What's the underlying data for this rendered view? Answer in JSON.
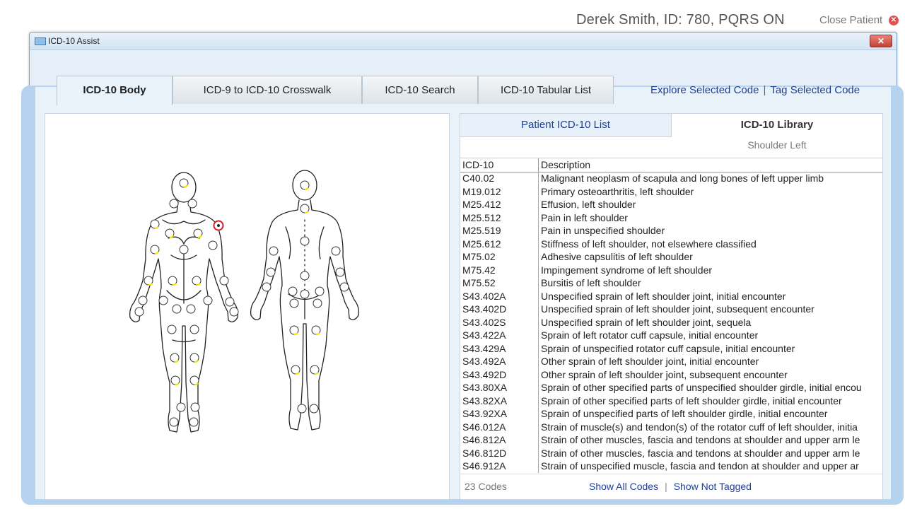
{
  "header": {
    "patient_info": "Derek Smith, ID: 780, PQRS ON",
    "close_patient_label": "Close Patient",
    "close_patient_glyph": "✕"
  },
  "window": {
    "title": "ICD-10 Assist",
    "close_glyph": "✕"
  },
  "tabs": [
    {
      "label": "ICD-10 Body",
      "active": true
    },
    {
      "label": "ICD-9 to ICD-10 Crosswalk",
      "active": false
    },
    {
      "label": "ICD-10 Search",
      "active": false
    },
    {
      "label": "ICD-10 Tabular List",
      "active": false
    }
  ],
  "top_links": {
    "explore": "Explore Selected Code",
    "tag": "Tag Selected Code",
    "separator": "|"
  },
  "right_panel": {
    "subtab_patient": "Patient ICD-10 List",
    "subtab_library": "ICD-10 Library",
    "selected_region": "Shoulder Left",
    "columns": {
      "code": "ICD-10",
      "description": "Description"
    },
    "rows": [
      {
        "code": "C40.02",
        "description": "Malignant neoplasm of scapula and long bones of left upper limb"
      },
      {
        "code": "M19.012",
        "description": "Primary osteoarthritis, left shoulder"
      },
      {
        "code": "M25.412",
        "description": "Effusion, left shoulder"
      },
      {
        "code": "M25.512",
        "description": "Pain in left shoulder"
      },
      {
        "code": "M25.519",
        "description": "Pain in unspecified shoulder"
      },
      {
        "code": "M25.612",
        "description": "Stiffness of left shoulder, not elsewhere classified"
      },
      {
        "code": "M75.02",
        "description": "Adhesive capsulitis of left shoulder"
      },
      {
        "code": "M75.42",
        "description": "Impingement syndrome of left shoulder"
      },
      {
        "code": "M75.52",
        "description": "Bursitis of left shoulder"
      },
      {
        "code": "S43.402A",
        "description": "Unspecified sprain of left shoulder joint, initial encounter"
      },
      {
        "code": "S43.402D",
        "description": "Unspecified sprain of left shoulder joint, subsequent encounter"
      },
      {
        "code": "S43.402S",
        "description": "Unspecified sprain of left shoulder joint, sequela"
      },
      {
        "code": "S43.422A",
        "description": "Sprain of left rotator cuff capsule, initial encounter"
      },
      {
        "code": "S43.429A",
        "description": "Sprain of unspecified rotator cuff capsule, initial encounter"
      },
      {
        "code": "S43.492A",
        "description": "Other sprain of left shoulder joint, initial encounter"
      },
      {
        "code": "S43.492D",
        "description": "Other sprain of left shoulder joint, subsequent encounter"
      },
      {
        "code": "S43.80XA",
        "description": "Sprain of other specified parts of unspecified shoulder girdle, initial encou"
      },
      {
        "code": "S43.82XA",
        "description": "Sprain of other specified parts of left shoulder girdle, initial encounter"
      },
      {
        "code": "S43.92XA",
        "description": "Sprain of unspecified parts of left shoulder girdle, initial encounter"
      },
      {
        "code": "S46.012A",
        "description": "Strain of muscle(s) and tendon(s) of the rotator cuff of left shoulder, initia"
      },
      {
        "code": "S46.812A",
        "description": "Strain of other muscles, fascia and tendons at shoulder and upper arm le"
      },
      {
        "code": "S46.812D",
        "description": "Strain of other muscles, fascia and tendons at shoulder and upper arm le"
      },
      {
        "code": "S46.912A",
        "description": "Strain of unspecified muscle, fascia and tendon at shoulder and upper ar"
      }
    ],
    "code_count": "23 Codes",
    "show_all": "Show All Codes",
    "show_not_tagged": "Show Not Tagged",
    "footer_separator": "|"
  },
  "colors": {
    "link": "#1c3d99",
    "hotspot_fill": "#ffffff",
    "hotspot_accent": "#f2e600",
    "selected_hotspot": "#d0202a"
  }
}
